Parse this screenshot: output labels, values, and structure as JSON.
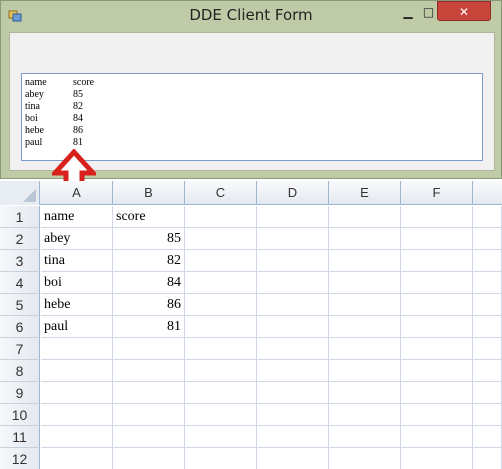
{
  "window": {
    "title": "DDE Client Form",
    "min_glyph": "▁",
    "max_glyph": "□",
    "close_glyph": "✕",
    "textbox_lines": [
      [
        "name",
        "score"
      ],
      [
        "abey",
        "85"
      ],
      [
        "tina",
        "82"
      ],
      [
        "boi",
        "84"
      ],
      [
        "hebe",
        "86"
      ],
      [
        "paul",
        "81"
      ]
    ]
  },
  "sheet": {
    "columns": [
      "A",
      "B",
      "C",
      "D",
      "E",
      "F"
    ],
    "rows": [
      "1",
      "2",
      "3",
      "4",
      "5",
      "6",
      "7",
      "8",
      "9",
      "10",
      "11",
      "12"
    ],
    "cells": [
      [
        "name",
        "score"
      ],
      [
        "abey",
        "85"
      ],
      [
        "tina",
        "82"
      ],
      [
        "boi",
        "84"
      ],
      [
        "hebe",
        "86"
      ],
      [
        "paul",
        "81"
      ]
    ]
  },
  "colors": {
    "window_frame": "#bfcba6",
    "close_button": "#c7453b",
    "arrow": "#d8201c",
    "grid_line": "#d0d7e5"
  }
}
